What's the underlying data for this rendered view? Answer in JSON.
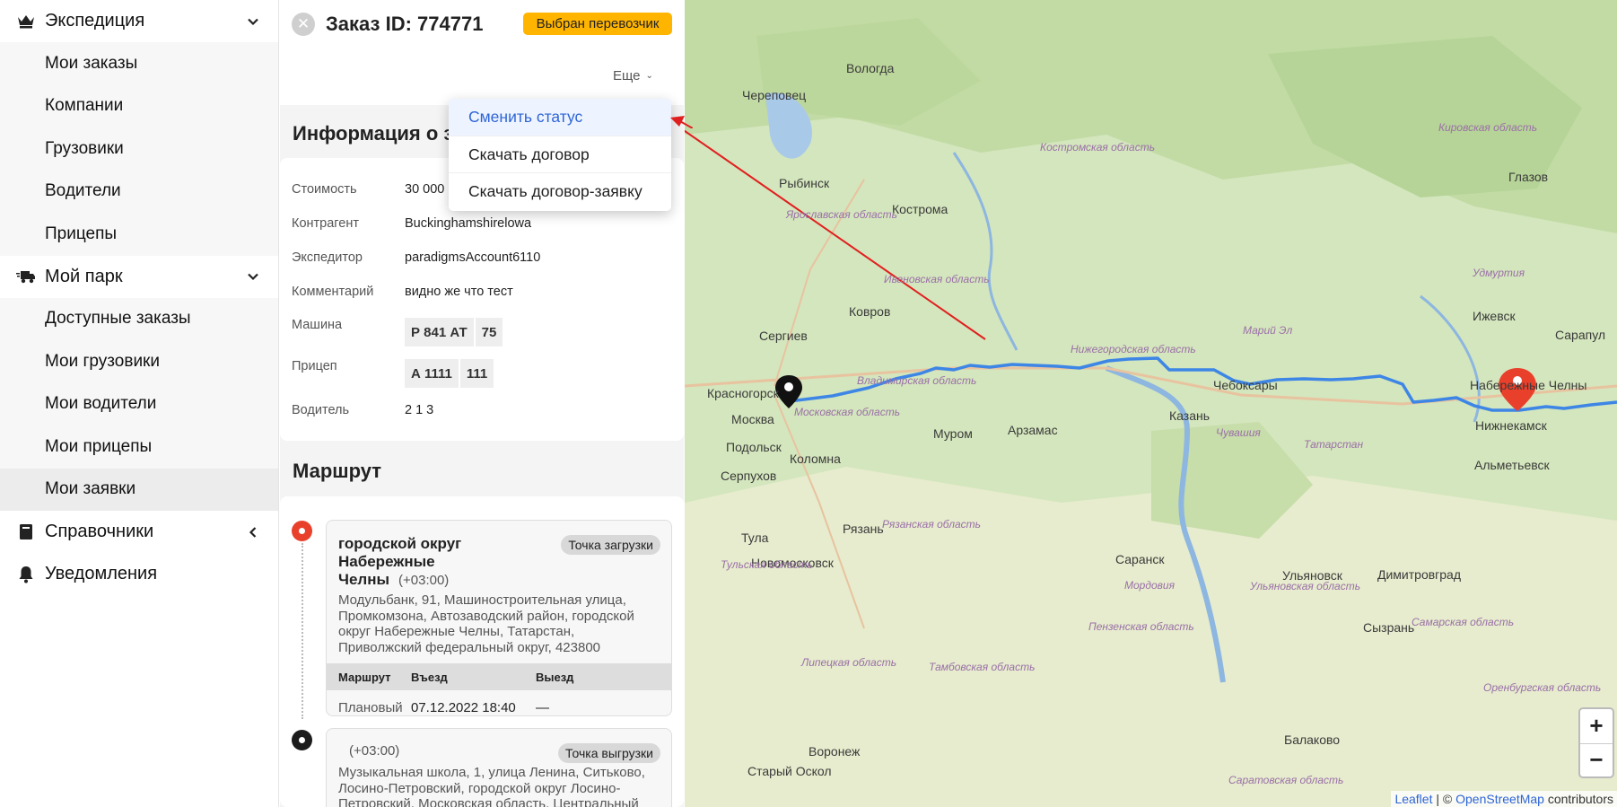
{
  "sidebar": {
    "groups": [
      {
        "label": "Экспедиция",
        "icon": "crown-icon",
        "items": [
          "Мои заказы",
          "Компании",
          "Грузовики",
          "Водители",
          "Прицепы"
        ]
      },
      {
        "label": "Мой парк",
        "icon": "truck-icon",
        "items": [
          "Доступные заказы",
          "Мои грузовики",
          "Мои водители",
          "Мои прицепы",
          "Мои заявки"
        ]
      },
      {
        "label": "Справочники",
        "icon": "book-icon"
      },
      {
        "label": "Уведомления",
        "icon": "bell-icon"
      }
    ]
  },
  "order": {
    "title": "Заказ ID: 774771",
    "status": "Выбран перевозчик",
    "more_label": "Еще",
    "info_title": "Информация о з",
    "fields": {
      "cost_label": "Стоимость",
      "cost_value": "30 000",
      "contractor_label": "Контрагент",
      "contractor_value": "Buckinghamshirelowa",
      "forwarder_label": "Экспедитор",
      "forwarder_value": "paradigmsAccount6110",
      "comment_label": "Комментарий",
      "comment_value": "видно же что тест",
      "vehicle_label": "Машина",
      "vehicle_plate": "Р 841 АТ",
      "vehicle_region": "75",
      "trailer_label": "Прицеп",
      "trailer_plate": "А 1111",
      "trailer_region": "111",
      "driver_label": "Водитель",
      "driver_value": "2 1 3"
    }
  },
  "dropdown": {
    "items": [
      "Сменить статус",
      "Скачать договор",
      "Скачать договор-заявку"
    ]
  },
  "route": {
    "title": "Маршрут",
    "points": [
      {
        "city_line1": "городской округ",
        "city_line2": "Набережные Челны",
        "tz": "(+03:00)",
        "badge": "Точка загрузки",
        "address": "Модульбанк, 91, Машиностроительная улица, Промкомзона, Автозаводский район, городской округ Набережные Челны, Татарстан, Приволжский федеральный округ, 423800",
        "table": {
          "col1": "Маршрут",
          "col2": "Въезд",
          "col3": "Выезд",
          "row_label": "Плановый",
          "entry": "07.12.2022 18:40",
          "exit": "—"
        }
      },
      {
        "tz": "(+03:00)",
        "badge": "Точка выгрузки",
        "address": "Музыкальная школа, 1, улица Ленина, Ситьково, Лосино-Петровский, городской округ Лосино-Петровский, Московская область, Центральный"
      }
    ]
  },
  "map": {
    "labels": [
      "Вологда",
      "Череповец",
      "Кострома",
      "Рыбинск",
      "Сергиев",
      "Ковров",
      "Красногорск",
      "Москва",
      "Подольск",
      "Коломна",
      "Серпухов",
      "Муром",
      "Арзамас",
      "Чебоксары",
      "Казань",
      "Набережные Челны",
      "Нижнекамск",
      "Ижевск",
      "Сарапул",
      "Глазов",
      "Рязань",
      "Тула",
      "Новомосковск",
      "Саранск",
      "Ульяновск",
      "Димитровград",
      "Сызрань",
      "Балаково",
      "Воронеж",
      "Старый Оскол",
      "Альметьевск"
    ],
    "regions": [
      "Кировская область",
      "Костромская область",
      "Ярославская область",
      "Ивановская область",
      "Владимирская область",
      "Нижегородская область",
      "Московская область",
      "Марий Эл",
      "Удмуртия",
      "Чувашия",
      "Татарстан",
      "Рязанская область",
      "Тульская область",
      "Мордовия",
      "Ульяновская область",
      "Пензенская область",
      "Самарская область",
      "Липецкая область",
      "Тамбовская область",
      "Саратовская область",
      "Оренбургская область"
    ],
    "zoom_in": "+",
    "zoom_out": "−",
    "attrib_leaflet": "Leaflet",
    "attrib_sep": " | © ",
    "attrib_osm": "OpenStreetMap",
    "attrib_tail": " contributors"
  },
  "colors": {
    "accent": "#ffb400",
    "route": "#3d86e6",
    "link": "#2e64d6",
    "pin_red": "#e9402b"
  }
}
